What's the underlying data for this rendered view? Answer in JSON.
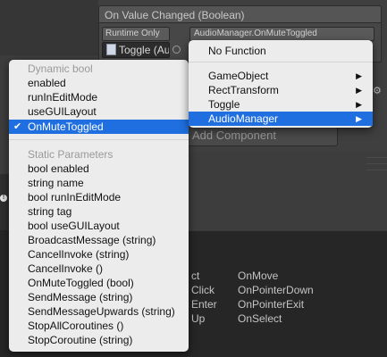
{
  "event": {
    "header": "On Value Changed (Boolean)",
    "runtime_option": "Runtime Only",
    "function": "AudioManager.OnMuteToggled",
    "object": "Toggle (Au"
  },
  "add_component_label": "Add Component",
  "left_menu": {
    "dynamic_header": "Dynamic bool",
    "dynamic_items": [
      "enabled",
      "runInEditMode",
      "useGUILayout",
      "OnMuteToggled"
    ],
    "selected": "OnMuteToggled",
    "static_header": "Static Parameters",
    "static_items": [
      "bool enabled",
      "string name",
      "bool runInEditMode",
      "string tag",
      "bool useGUILayout",
      "BroadcastMessage (string)",
      "CancelInvoke (string)",
      "CancelInvoke ()",
      "OnMuteToggled (bool)",
      "SendMessage (string)",
      "SendMessageUpwards (string)",
      "StopAllCoroutines ()",
      "StopCoroutine (string)"
    ]
  },
  "right_menu": {
    "items": [
      "No Function",
      "GameObject",
      "RectTransform",
      "Toggle",
      "AudioManager"
    ],
    "selected": "AudioManager"
  },
  "background_events": {
    "col1": [
      "ct",
      "Click",
      "Enter",
      "Up"
    ],
    "col2": [
      "OnMove",
      "OnPointerDown",
      "OnPointerExit",
      "OnSelect"
    ]
  }
}
